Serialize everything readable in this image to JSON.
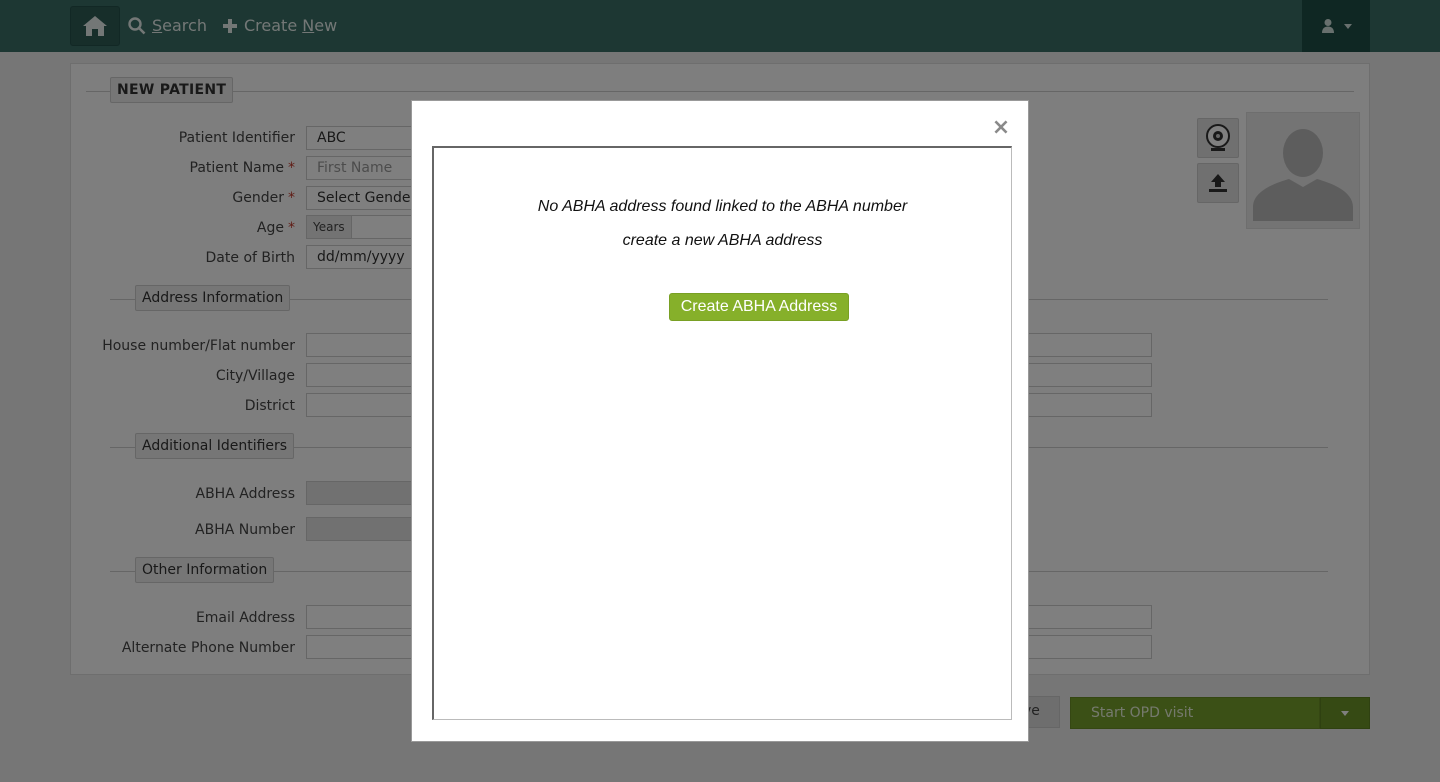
{
  "navbar": {
    "search_label_pre": "",
    "search_label_ul": "S",
    "search_label_post": "earch",
    "create_label_pre": "Create ",
    "create_label_ul": "N",
    "create_label_post": "ew"
  },
  "form": {
    "legend_new_patient": "NEW PATIENT",
    "patient_identifier_label": "Patient Identifier",
    "patient_identifier_value": "ABC",
    "patient_name_label": "Patient Name",
    "first_name_placeholder": "First Name",
    "gender_label": "Gender",
    "gender_value": "Select Gender",
    "age_label": "Age",
    "age_years_tag": "Years",
    "dob_label": "Date of Birth",
    "dob_value": "dd/mm/yyyy",
    "required_mark": "*",
    "legend_address": "Address Information",
    "house_label": "House number/Flat number",
    "city_label": "City/Village",
    "district_label": "District",
    "legend_additional": "Additional Identifiers",
    "abha_address_label": "ABHA Address",
    "abha_number_label": "ABHA Number",
    "legend_other": "Other Information",
    "email_label": "Email Address",
    "alt_phone_label": "Alternate Phone Number"
  },
  "footer": {
    "save_partial": "ve",
    "start_opd_label": "Start OPD visit"
  },
  "modal": {
    "close_symbol": "×",
    "message_line1": "No ABHA address found linked to the ABHA number",
    "message_line2": "create a new ABHA address",
    "create_button_label": "Create ABHA Address"
  },
  "colors": {
    "navbar": "#3a6e66",
    "primary_green": "#76a02c",
    "create_button": "#86b02a"
  }
}
